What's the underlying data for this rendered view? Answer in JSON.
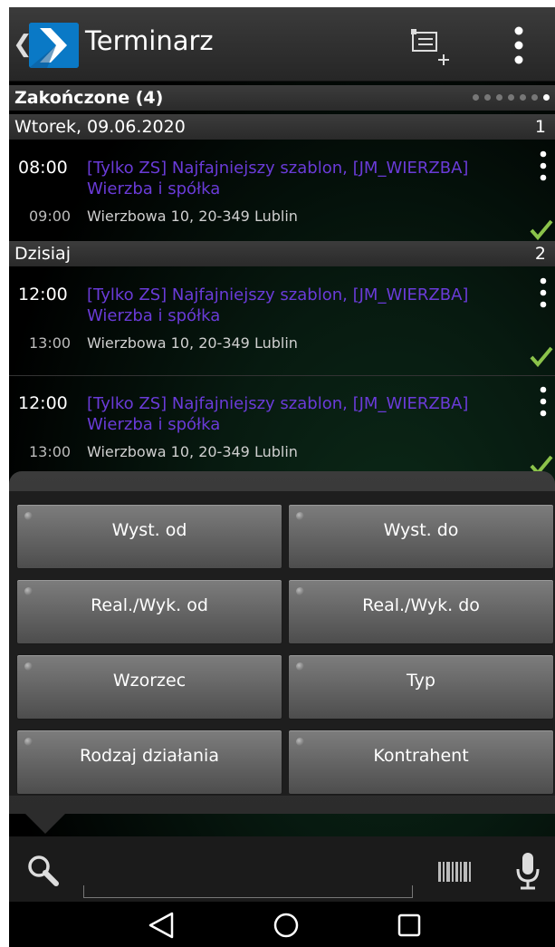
{
  "app": {
    "title": "Terminarz",
    "back_icon": "chevron-left-icon",
    "add_icon": "add-event-icon",
    "menu_icon": "more-vert-icon"
  },
  "sections": [
    {
      "label": "Zakończone (4)",
      "pager": {
        "total": 7,
        "active_index": 6
      }
    },
    {
      "label": "Wtorek, 09.06.2020",
      "count": "1"
    },
    {
      "label": "Dzisiaj",
      "count": "2"
    }
  ],
  "events": [
    {
      "start": "08:00",
      "end": "09:00",
      "title": "[Tylko ZS] Najfajniejszy szablon, [JM_WIERZBA] Wierzba i spółka",
      "address": "Wierzbowa 10, 20-349 Lublin",
      "completed": true
    },
    {
      "start": "12:00",
      "end": "13:00",
      "title": "[Tylko ZS] Najfajniejszy szablon, [JM_WIERZBA] Wierzba i spółka",
      "address": "Wierzbowa 10, 20-349 Lublin",
      "completed": true
    },
    {
      "start": "12:00",
      "end": "13:00",
      "title": "[Tylko ZS] Najfajniejszy szablon, [JM_WIERZBA] Wierzba i spółka",
      "address": "Wierzbowa 10, 20-349 Lublin",
      "completed": true
    }
  ],
  "filters": {
    "buttons": [
      "Wyst. od",
      "Wyst. do",
      "Real./Wyk. od",
      "Real./Wyk. do",
      "Wzorzec",
      "Typ",
      "Rodzaj działania",
      "Kontrahent"
    ]
  },
  "search": {
    "value": "",
    "placeholder": ""
  },
  "colors": {
    "event_title": "#6a3bd8",
    "check": "#8bc34a",
    "logo_bg": "#0a79c6"
  },
  "nav": {
    "icons": [
      "back-triangle-icon",
      "home-circle-icon",
      "recents-square-icon"
    ]
  }
}
